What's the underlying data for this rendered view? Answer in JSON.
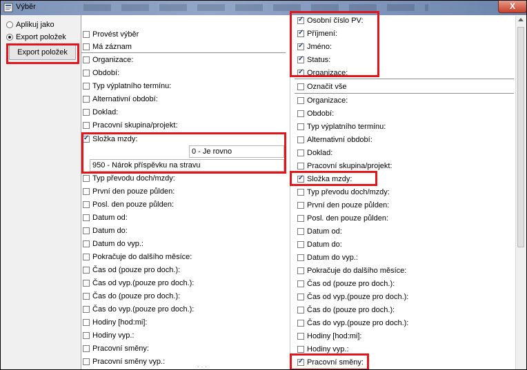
{
  "window": {
    "title": "Výběr",
    "close_symbol": "X"
  },
  "left_panel": {
    "radio_apply": "Aplikuj jako",
    "radio_export": "Export položek",
    "export_button": "Export položek"
  },
  "middle_panel": {
    "top_items": [
      {
        "label": "Provést výběr",
        "checked": false
      },
      {
        "label": "Má záznam",
        "checked": false
      }
    ],
    "items_a": [
      {
        "label": "Organizace:",
        "checked": false
      },
      {
        "label": "Období:",
        "checked": false
      },
      {
        "label": "Typ výplatního termínu:",
        "checked": false
      },
      {
        "label": "Alternativní období:",
        "checked": false
      },
      {
        "label": "Doklad:",
        "checked": false
      },
      {
        "label": "Pracovní skupina/projekt:",
        "checked": false
      }
    ],
    "salary_item": {
      "label": "Složka mzdy:",
      "checked": true
    },
    "condition_value": "0 - Je rovno",
    "salary_value": "950 - Nárok příspěvku na stravu",
    "items_b": [
      {
        "label": "Typ převodu doch/mzdy:",
        "checked": false
      },
      {
        "label": "První den pouze půlden:",
        "checked": false
      },
      {
        "label": "Posl. den pouze půlden:",
        "checked": false
      },
      {
        "label": "Datum od:",
        "checked": false
      },
      {
        "label": "Datum do:",
        "checked": false
      },
      {
        "label": "Datum do vyp.:",
        "checked": false
      },
      {
        "label": "Pokračuje do dalšího měsíce:",
        "checked": false
      },
      {
        "label": "Čas od (pouze pro doch.):",
        "checked": false
      },
      {
        "label": "Čas od vyp.(pouze pro doch.):",
        "checked": false
      },
      {
        "label": "Čas do (pouze pro doch.):",
        "checked": false
      },
      {
        "label": "Čas do vyp.(pouze pro doch.):",
        "checked": false
      },
      {
        "label": "Hodiny [hod:mi]:",
        "checked": false
      },
      {
        "label": "Hodiny vyp.:",
        "checked": false
      },
      {
        "label": "Pracovní směny:",
        "checked": false
      },
      {
        "label": "Pracovní směny vyp.:",
        "checked": false
      }
    ]
  },
  "right_panel": {
    "top_items": [
      {
        "label": "Osobní číslo PV:",
        "checked": true
      },
      {
        "label": "Příjmení:",
        "checked": true
      },
      {
        "label": "Jméno:",
        "checked": true
      },
      {
        "label": "Status:",
        "checked": true
      },
      {
        "label": "Organizace:",
        "checked": true
      }
    ],
    "select_all": {
      "label": "Označit vše",
      "checked": false
    },
    "items": [
      {
        "label": "Organizace:",
        "checked": false
      },
      {
        "label": "Období:",
        "checked": false
      },
      {
        "label": "Typ výplatního termínu:",
        "checked": false
      },
      {
        "label": "Alternativní období:",
        "checked": false
      },
      {
        "label": "Doklad:",
        "checked": false
      },
      {
        "label": "Pracovní skupina/projekt:",
        "checked": false
      },
      {
        "label": "Složka mzdy:",
        "checked": true
      },
      {
        "label": "Typ převodu doch/mzdy:",
        "checked": false
      },
      {
        "label": "První den pouze půlden:",
        "checked": false
      },
      {
        "label": "Posl. den pouze půlden:",
        "checked": false
      },
      {
        "label": "Datum od:",
        "checked": false
      },
      {
        "label": "Datum do:",
        "checked": false
      },
      {
        "label": "Datum do vyp.:",
        "checked": false
      },
      {
        "label": "Pokračuje do dalšího měsíce:",
        "checked": false
      },
      {
        "label": "Čas od (pouze pro doch.):",
        "checked": false
      },
      {
        "label": "Čas od vyp.(pouze pro doch.):",
        "checked": false
      },
      {
        "label": "Čas do (pouze pro doch.):",
        "checked": false
      },
      {
        "label": "Čas do vyp.(pouze pro doch.):",
        "checked": false
      },
      {
        "label": "Hodiny [hod:mi]:",
        "checked": false
      },
      {
        "label": "Hodiny vyp.:",
        "checked": false
      },
      {
        "label": "Pracovní směny:",
        "checked": true
      }
    ]
  },
  "colors": {
    "highlight": "#e4141b",
    "titlebar": "#8ca0c2",
    "check": "#1a3c8a"
  }
}
